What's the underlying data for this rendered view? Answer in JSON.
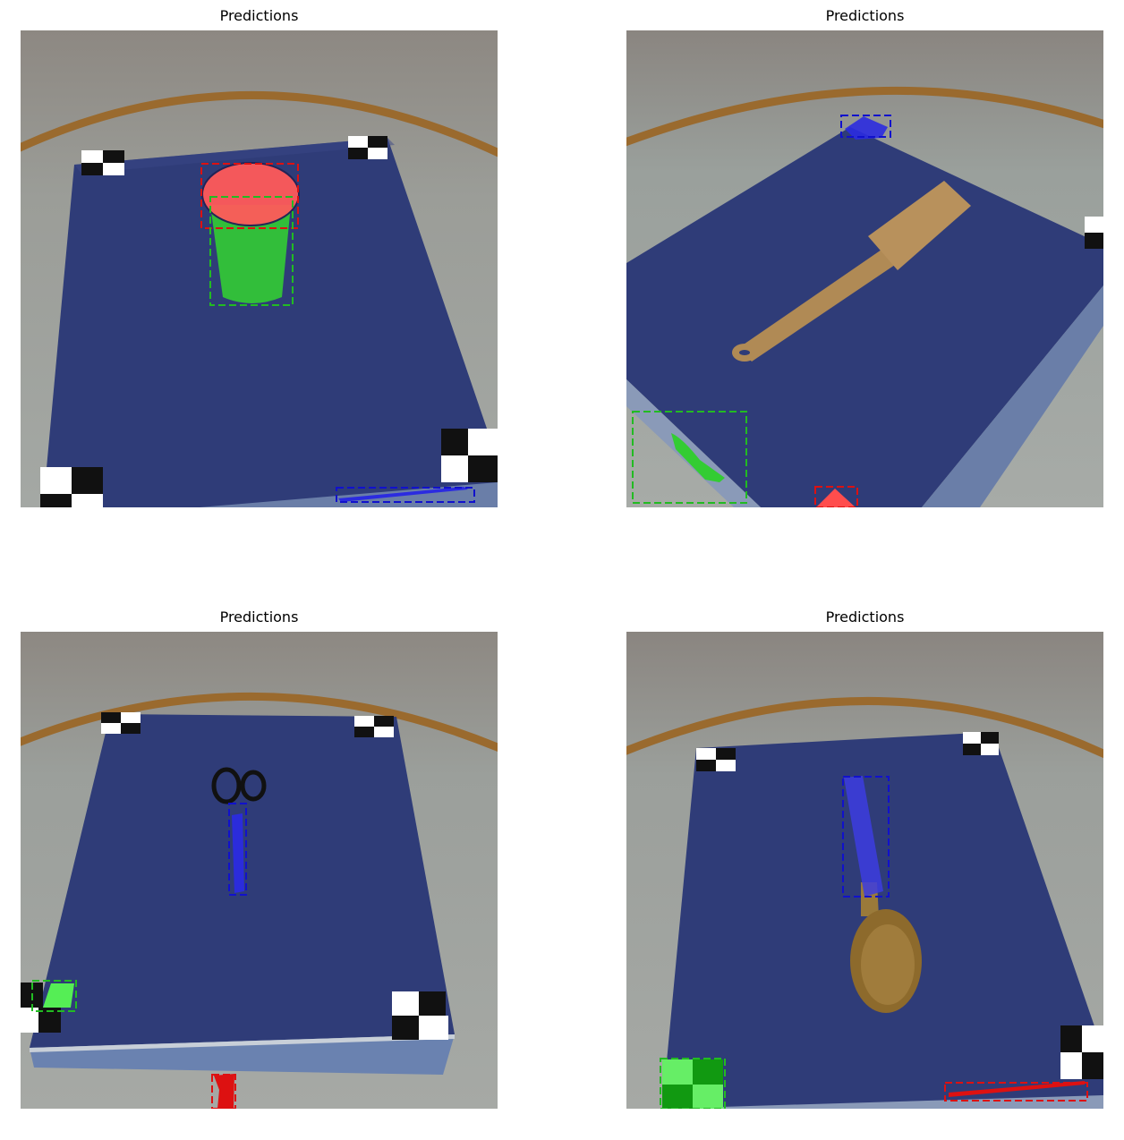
{
  "panels": [
    {
      "title": "Predictions",
      "scene": "cup"
    },
    {
      "title": "Predictions",
      "scene": "spatula"
    },
    {
      "title": "Predictions",
      "scene": "scissors"
    },
    {
      "title": "Predictions",
      "scene": "spoon"
    }
  ],
  "colors": {
    "background_wall": "#8f8a84",
    "floor": "#9aa09b",
    "ring": "#9a6a2e",
    "board": "#2f3c78",
    "mask_red": "#ff4d4d",
    "mask_green": "#33cc33",
    "mask_blue": "#2b2be0"
  }
}
